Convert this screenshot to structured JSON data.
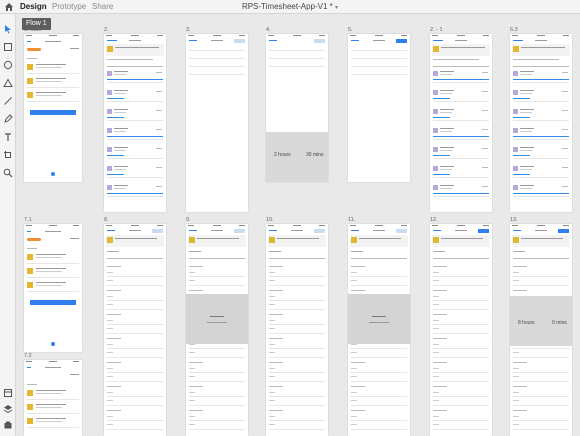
{
  "app": {
    "tabs": [
      "Design",
      "Prototype",
      "Share"
    ],
    "document_title": "RPS-Timesheet-App-V1 *"
  },
  "flow_label": "Flow 1",
  "tools": [
    "select-icon",
    "rectangle-icon",
    "ellipse-icon",
    "triangle-icon",
    "line-icon",
    "pen-icon",
    "text-icon",
    "artboard-icon",
    "zoom-icon"
  ],
  "bottom_tools": [
    "assets-icon",
    "layers-icon",
    "plugins-icon"
  ],
  "artboards": [
    {
      "label": "1. Start",
      "kind": "start"
    },
    {
      "label": "2.",
      "kind": "week"
    },
    {
      "label": "3.",
      "kind": "blank"
    },
    {
      "label": "4.",
      "kind": "picker",
      "picker": [
        "2 hours",
        "30 mins"
      ]
    },
    {
      "label": "5.",
      "kind": "blank2"
    },
    {
      "label": "2. - 1",
      "kind": "week"
    },
    {
      "label": "6.3",
      "kind": "week"
    },
    {
      "label": "7.1",
      "kind": "start"
    },
    {
      "label": "8.",
      "kind": "entry"
    },
    {
      "label": "9.",
      "kind": "entry-modal"
    },
    {
      "label": "10.",
      "kind": "entry"
    },
    {
      "label": "11.",
      "kind": "entry-modal2"
    },
    {
      "label": "12.",
      "kind": "entry"
    },
    {
      "label": "13.",
      "kind": "entry-picker",
      "picker": [
        "8 hours",
        "0 mins"
      ]
    },
    {
      "label": "7.2",
      "kind": "start-bottom"
    }
  ]
}
